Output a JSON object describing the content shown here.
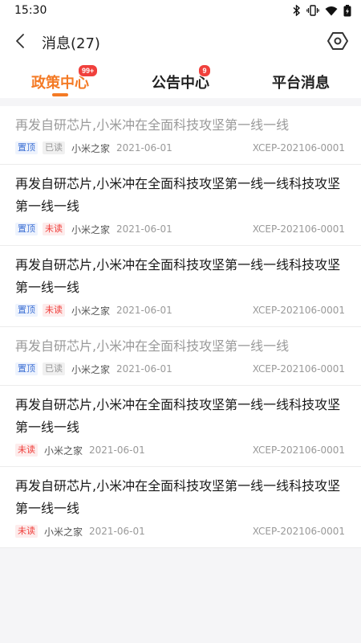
{
  "status_bar": {
    "time": "15:30"
  },
  "nav": {
    "title": "消息(27)"
  },
  "tabs": [
    {
      "label": "政策中心",
      "badge": "99+",
      "active": true
    },
    {
      "label": "公告中心",
      "badge": "9",
      "active": false
    },
    {
      "label": "平台消息",
      "badge": "",
      "active": false
    }
  ],
  "messages": [
    {
      "title": "再发自研芯片,小米冲在全面科技攻坚第一线一线",
      "read": true,
      "pinned": true,
      "pin_label": "置顶",
      "status_label": "已读",
      "source": "小米之家",
      "date": "2021-06-01",
      "code": "XCEP-202106-0001"
    },
    {
      "title": "再发自研芯片,小米冲在全面科技攻坚第一线一线科技攻坚第一线一线",
      "read": false,
      "pinned": true,
      "pin_label": "置顶",
      "status_label": "未读",
      "source": "小米之家",
      "date": "2021-06-01",
      "code": "XCEP-202106-0001"
    },
    {
      "title": "再发自研芯片,小米冲在全面科技攻坚第一线一线科技攻坚第一线一线",
      "read": false,
      "pinned": true,
      "pin_label": "置顶",
      "status_label": "未读",
      "source": "小米之家",
      "date": "2021-06-01",
      "code": "XCEP-202106-0001"
    },
    {
      "title": "再发自研芯片,小米冲在全面科技攻坚第一线一线",
      "read": true,
      "pinned": true,
      "pin_label": "置顶",
      "status_label": "已读",
      "source": "小米之家",
      "date": "2021-06-01",
      "code": "XCEP-202106-0001"
    },
    {
      "title": "再发自研芯片,小米冲在全面科技攻坚第一线一线科技攻坚第一线一线",
      "read": false,
      "pinned": false,
      "pin_label": "",
      "status_label": "未读",
      "source": "小米之家",
      "date": "2021-06-01",
      "code": "XCEP-202106-0001"
    },
    {
      "title": "再发自研芯片,小米冲在全面科技攻坚第一线一线科技攻坚第一线一线",
      "read": false,
      "pinned": false,
      "pin_label": "",
      "status_label": "未读",
      "source": "小米之家",
      "date": "2021-06-01",
      "code": "XCEP-202106-0001"
    }
  ],
  "colors": {
    "accent": "#f47a25",
    "badge": "#f0403c",
    "pin": "#3b6fd4",
    "unread": "#f0403c"
  },
  "icons": {
    "back": "chevron-left-icon",
    "settings": "hexagon-settings-icon"
  }
}
